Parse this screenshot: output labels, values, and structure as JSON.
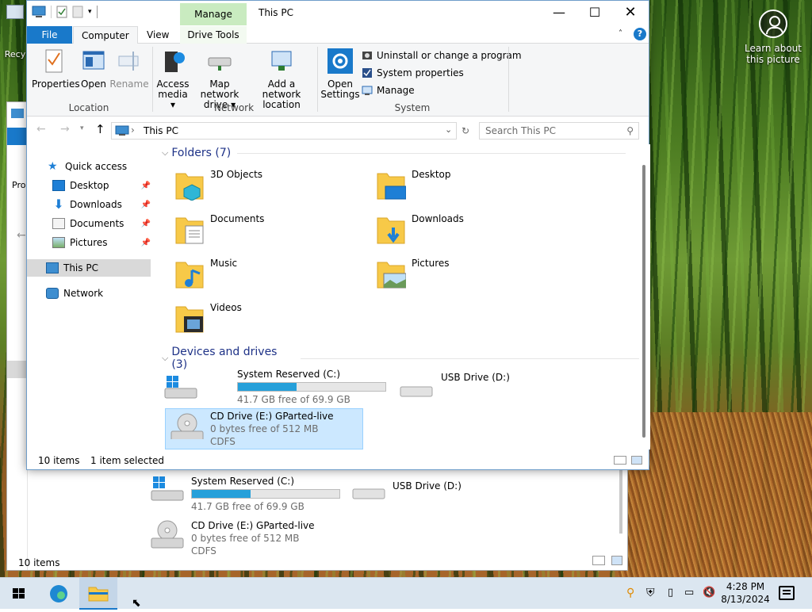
{
  "desktop": {
    "recycle_label": "Recy",
    "learn_label": "Learn about this picture"
  },
  "back_window": {
    "side_label_pro": "Pro",
    "drives": [
      {
        "name": "System Reserved (C:)",
        "free": "41.7 GB free of 69.9 GB",
        "used_fraction": 0.4
      },
      {
        "name": "USB Drive (D:)"
      },
      {
        "name": "CD Drive (E:) GParted-live",
        "free": "0 bytes free of 512 MB",
        "fs": "CDFS"
      }
    ],
    "status_items": "10 items"
  },
  "window": {
    "title": "This PC",
    "context_tab": "Manage",
    "tabs": {
      "file": "File",
      "computer": "Computer",
      "view": "View",
      "drive_tools": "Drive Tools"
    },
    "ribbon": {
      "location": {
        "label": "Location",
        "properties": "Properties",
        "open": "Open",
        "rename": "Rename"
      },
      "network": {
        "label": "Network",
        "access_media": "Access media",
        "map_drive": "Map network drive",
        "add_location": "Add a network location"
      },
      "system": {
        "label": "System",
        "open_settings": "Open Settings",
        "uninstall": "Uninstall or change a program",
        "system_properties": "System properties",
        "manage": "Manage"
      }
    },
    "address": {
      "path": "This PC",
      "search_placeholder": "Search This PC"
    },
    "nav": {
      "quick_access": "Quick access",
      "items": [
        {
          "label": "Desktop"
        },
        {
          "label": "Downloads"
        },
        {
          "label": "Documents"
        },
        {
          "label": "Pictures"
        }
      ],
      "this_pc": "This PC",
      "network": "Network"
    },
    "folders_header": "Folders (7)",
    "folders": [
      {
        "label": "3D Objects"
      },
      {
        "label": "Desktop"
      },
      {
        "label": "Documents"
      },
      {
        "label": "Downloads"
      },
      {
        "label": "Music"
      },
      {
        "label": "Pictures"
      },
      {
        "label": "Videos"
      }
    ],
    "drives_header": "Devices and drives (3)",
    "drives": [
      {
        "name": "System Reserved (C:)",
        "free": "41.7 GB free of 69.9 GB",
        "used_fraction": 0.4
      },
      {
        "name": "USB Drive (D:)"
      },
      {
        "name": "CD Drive (E:) GParted-live",
        "free": "0 bytes free of 512 MB",
        "fs": "CDFS",
        "selected": true
      }
    ],
    "status": {
      "items": "10 items",
      "selected": "1 item selected"
    }
  },
  "taskbar": {
    "time": "4:28 PM",
    "date": "8/13/2024",
    "accent": "#1979ca"
  }
}
